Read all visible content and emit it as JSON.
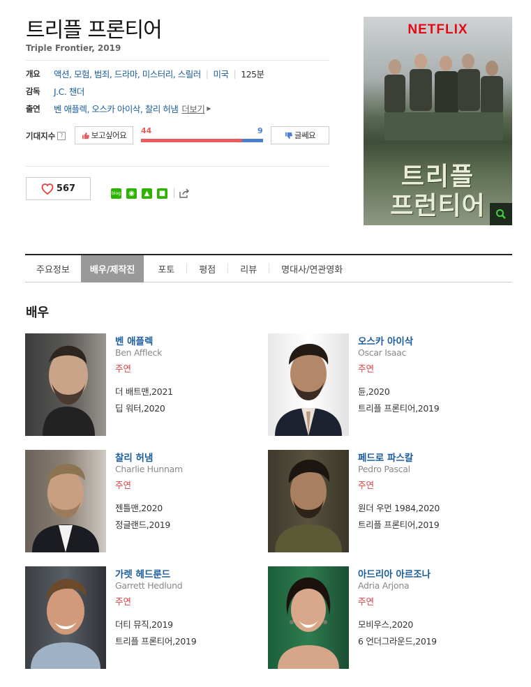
{
  "movie": {
    "title_ko": "트리플 프론티어",
    "subtitle": "Triple Frontier, 2019",
    "summary_label": "개요",
    "genres": "액션, 모험, 범죄, 드라마, 미스터리, 스릴러",
    "country": "미국",
    "runtime": "125분",
    "director_label": "감독",
    "director": "J.C. 챈더",
    "cast_label": "출연",
    "cast": "벤 애플렉, 오스카 아이삭, 찰리 허냄",
    "more_label": "더보기"
  },
  "rating": {
    "label": "기대지수",
    "help": "?",
    "want_label": "보고싶어요",
    "want_count": "44",
    "meh_label": "글쎄요",
    "meh_count": "9",
    "want_fraction": 0.83,
    "colors": {
      "want": "#e85c5f",
      "meh": "#4c7ed2"
    }
  },
  "social": {
    "like_count": "567",
    "share_icons": [
      "blog-icon",
      "band-icon",
      "bookmark-icon",
      "line-icon",
      "share-icon"
    ]
  },
  "poster": {
    "brand": "NETFLIX",
    "title_line1": "트리플",
    "title_line2": "프런티어",
    "zoom_icon": "search-icon"
  },
  "tabs": [
    {
      "label": "주요정보",
      "active": false
    },
    {
      "label": "배우/제작진",
      "active": true
    },
    {
      "label": "포토",
      "active": false
    },
    {
      "label": "평점",
      "active": false
    },
    {
      "label": "리뷰",
      "active": false
    },
    {
      "label": "명대사/연관영화",
      "active": false
    }
  ],
  "section_title": "배우",
  "actors": [
    {
      "name": "벤 애플렉",
      "en": "Ben Affleck",
      "role": "주연",
      "film1": "더 배트맨,2021",
      "film2": "딥 워터,2020"
    },
    {
      "name": "오스카 아이삭",
      "en": "Oscar Isaac",
      "role": "주연",
      "film1": "듄,2020",
      "film2": "트리플 프론티어,2019"
    },
    {
      "name": "찰리 허냄",
      "en": "Charlie Hunnam",
      "role": "주연",
      "film1": "젠틀맨,2020",
      "film2": "정글랜드,2019"
    },
    {
      "name": "페드로 파스칼",
      "en": "Pedro Pascal",
      "role": "주연",
      "film1": "원더 우먼 1984,2020",
      "film2": "트리플 프론티어,2019"
    },
    {
      "name": "가렛 헤드룬드",
      "en": "Garrett Hedlund",
      "role": "주연",
      "film1": "더티 뮤직,2019",
      "film2": "트리플 프론티어,2019"
    },
    {
      "name": "아드리아 아르조나",
      "en": "Adria Arjona",
      "role": "주연",
      "film1": "모비우스,2020",
      "film2": "6 언더그라운드,2019"
    }
  ]
}
